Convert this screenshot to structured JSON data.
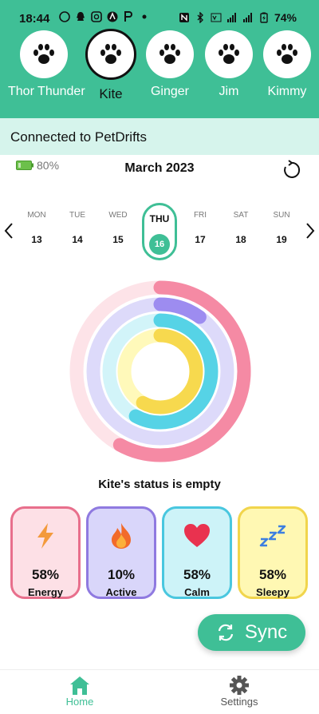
{
  "status_bar": {
    "time": "18:44",
    "battery": "74%"
  },
  "pets": [
    {
      "name": "Thor Thunder",
      "selected": false
    },
    {
      "name": "Kite",
      "selected": true
    },
    {
      "name": "Ginger",
      "selected": false
    },
    {
      "name": "Jim",
      "selected": false
    },
    {
      "name": "Kimmy",
      "selected": false
    }
  ],
  "connection": {
    "text": "Connected to PetDrifts"
  },
  "device": {
    "battery": "80%"
  },
  "calendar": {
    "month": "March 2023",
    "days": [
      {
        "name": "MON",
        "num": "13"
      },
      {
        "name": "TUE",
        "num": "14"
      },
      {
        "name": "WED",
        "num": "15"
      },
      {
        "name": "THU",
        "num": "16",
        "selected": true
      },
      {
        "name": "FRI",
        "num": "17"
      },
      {
        "name": "SAT",
        "num": "18"
      },
      {
        "name": "SUN",
        "num": "19"
      }
    ]
  },
  "status": {
    "text": "Kite's status is empty"
  },
  "metrics": [
    {
      "label": "Energy",
      "value": "58%",
      "percent": 58,
      "color": "#e86f8c",
      "bg": "#fde0e6",
      "ring": "#f58aa4"
    },
    {
      "label": "Active",
      "value": "10%",
      "percent": 10,
      "color": "#8f7ae0",
      "bg": "#d9d6fa",
      "ring": "#9d8cf0"
    },
    {
      "label": "Calm",
      "value": "58%",
      "percent": 58,
      "color": "#49c7df",
      "bg": "#cdf3f8",
      "ring": "#56d3e6"
    },
    {
      "label": "Sleepy",
      "value": "58%",
      "percent": 58,
      "color": "#f1d54c",
      "bg": "#fff8b3",
      "ring": "#f7d94e"
    }
  ],
  "sync_button": {
    "label": "Sync"
  },
  "bottom_nav": {
    "home": "Home",
    "settings": "Settings",
    "active_color": "#3fbf96"
  }
}
